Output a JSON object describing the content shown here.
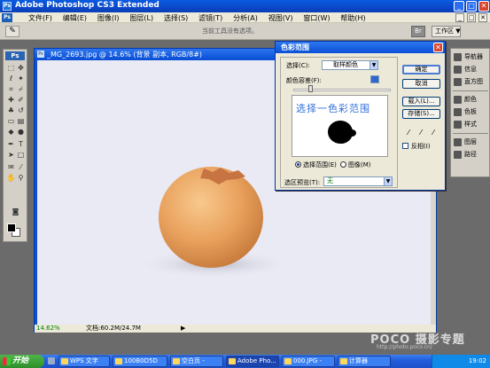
{
  "app": {
    "title": "Adobe Photoshop CS3 Extended",
    "badge": "Ps",
    "controls": {
      "minimize": "_",
      "maximize": "□",
      "close": "✕"
    }
  },
  "menu": {
    "items": [
      "文件(F)",
      "编辑(E)",
      "图像(I)",
      "图层(L)",
      "选择(S)",
      "滤镜(T)",
      "分析(A)",
      "视图(V)",
      "窗口(W)",
      "帮助(H)"
    ]
  },
  "options_bar": {
    "tool_icon": "eyedropper-icon",
    "hint": "当前工具没有选项。",
    "workspace_label": "工作区 ▼",
    "bridge_icon": "bridge-icon"
  },
  "toolbox": {
    "badge": "Ps"
  },
  "document": {
    "title": "_MG_2693.jpg @ 14.6% (背景 副本, RGB/8#)",
    "zoom": "14.62%",
    "doc_size": "文档:60.2M/24.7M",
    "status_arrow": "▶"
  },
  "panels": {
    "items": [
      {
        "label": "导航器",
        "icon": "navigator-icon"
      },
      {
        "label": "信息",
        "icon": "info-icon"
      },
      {
        "label": "直方图",
        "icon": "histogram-icon"
      },
      {
        "label": "颜色",
        "icon": "color-icon"
      },
      {
        "label": "色板",
        "icon": "swatches-icon"
      },
      {
        "label": "样式",
        "icon": "styles-icon"
      },
      {
        "label": "图层",
        "icon": "layers-icon"
      },
      {
        "label": "路径",
        "icon": "paths-icon"
      }
    ]
  },
  "dialog": {
    "title": "色彩范围",
    "select_label": "选择(C):",
    "select_value": "取样颜色",
    "fuzziness_label": "颜色容差(F):",
    "preview_text": "选择一色彩范围",
    "radio_selection": "选择范围(E)",
    "radio_image": "图像(M)",
    "selection_preview_label": "选区预览(T):",
    "selection_preview_value": "无",
    "buttons": {
      "ok": "确定",
      "cancel": "取消",
      "load": "载入(L)...",
      "save": "存储(S)..."
    },
    "invert_label": "反相(I)"
  },
  "taskbar": {
    "start_label": "开始",
    "tasks": [
      {
        "label": "WPS 文字"
      },
      {
        "label": "100B0D5D"
      },
      {
        "label": "空白页 -"
      },
      {
        "label": "Adobe Pho..."
      },
      {
        "label": "000.JPG -"
      },
      {
        "label": "计算器"
      }
    ],
    "clock": "19:02"
  },
  "watermark": {
    "text": "POCO 摄影专题",
    "url": "http://photo.poco.cn/"
  },
  "colors": {
    "xp_blue": "#0a4fd6",
    "dialog_bg": "#ece9d8",
    "canvas_bg": "#e9eaf4",
    "egg": "#e9a15d",
    "preview_text": "#2f6fd8"
  }
}
